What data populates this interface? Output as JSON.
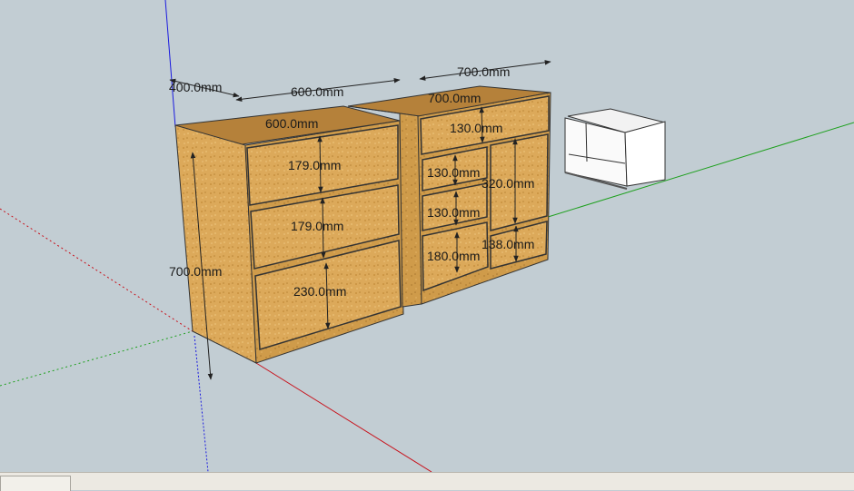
{
  "model": {
    "dimensions": {
      "left_depth": "400.0mm",
      "left_width_top": "600.0mm",
      "left_width_front": "600.0mm",
      "left_height": "700.0mm",
      "left_drawer_1": "179.0mm",
      "left_drawer_2": "179.0mm",
      "left_drawer_3": "230.0mm",
      "right_width_top": "700.0mm",
      "right_width_front": "700.0mm",
      "right_top_drawer": "130.0mm",
      "right_small_1": "130.0mm",
      "right_small_2": "130.0mm",
      "right_small_3": "180.0mm",
      "right_tall_1": "320.0mm",
      "right_tall_2": "138.0mm"
    }
  },
  "colors": {
    "background": "#c2cdd3",
    "wood": "#dba757",
    "wood_side": "#c99441",
    "axis_red": "#c8101a",
    "axis_green": "#1ea01e",
    "axis_blue": "#1a1ae0"
  }
}
